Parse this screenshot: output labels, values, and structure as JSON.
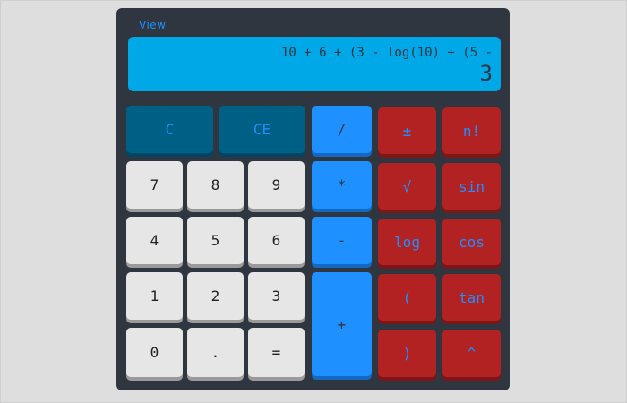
{
  "menu": {
    "view_label": "View"
  },
  "display": {
    "expression": "10 + 6 + (3 - log(10) + (5 -",
    "result": "3"
  },
  "buttons": {
    "c": "C",
    "ce": "CE",
    "divide": "/",
    "plus_minus": "±",
    "factorial": "n!",
    "seven": "7",
    "eight": "8",
    "nine": "9",
    "multiply": "*",
    "sqrt": "√",
    "sin": "sin",
    "four": "4",
    "five": "5",
    "six": "6",
    "minus": "-",
    "log": "log",
    "cos": "cos",
    "one": "1",
    "two": "2",
    "three": "3",
    "plus": "+",
    "open_paren": "(",
    "tan": "tan",
    "zero": "0",
    "decimal": ".",
    "equals": "=",
    "close_paren": ")",
    "power": "^"
  },
  "colors": {
    "body_bg": "#2f3640",
    "display_bg": "#00a8e8",
    "number_key": "#e6e6e6",
    "clear_key": "#005f85",
    "operator_key": "#1e90ff",
    "function_key": "#b22222",
    "accent_text": "#1e90ff"
  }
}
